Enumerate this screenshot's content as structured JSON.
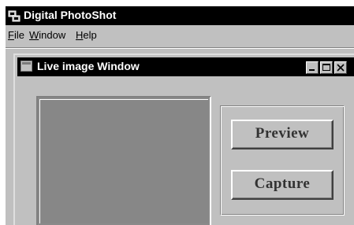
{
  "app": {
    "title": "Digital PhotoShot",
    "icon": "camera-app-icon"
  },
  "menubar": {
    "items": [
      {
        "label_u": "F",
        "label_rest": "ile"
      },
      {
        "label_u": "W",
        "label_rest": "indow"
      },
      {
        "label_u": "H",
        "label_rest": "elp"
      }
    ]
  },
  "child_window": {
    "title": "Live image Window",
    "controls": [
      "minimize-icon",
      "maximize-icon",
      "close-icon"
    ]
  },
  "controls": {
    "preview_label": "Preview",
    "capture_label": "Capture"
  },
  "colors": {
    "titlebar": "#000000",
    "face": "#c0c0c0",
    "live_image": "#878787",
    "button_text": "#333333"
  }
}
